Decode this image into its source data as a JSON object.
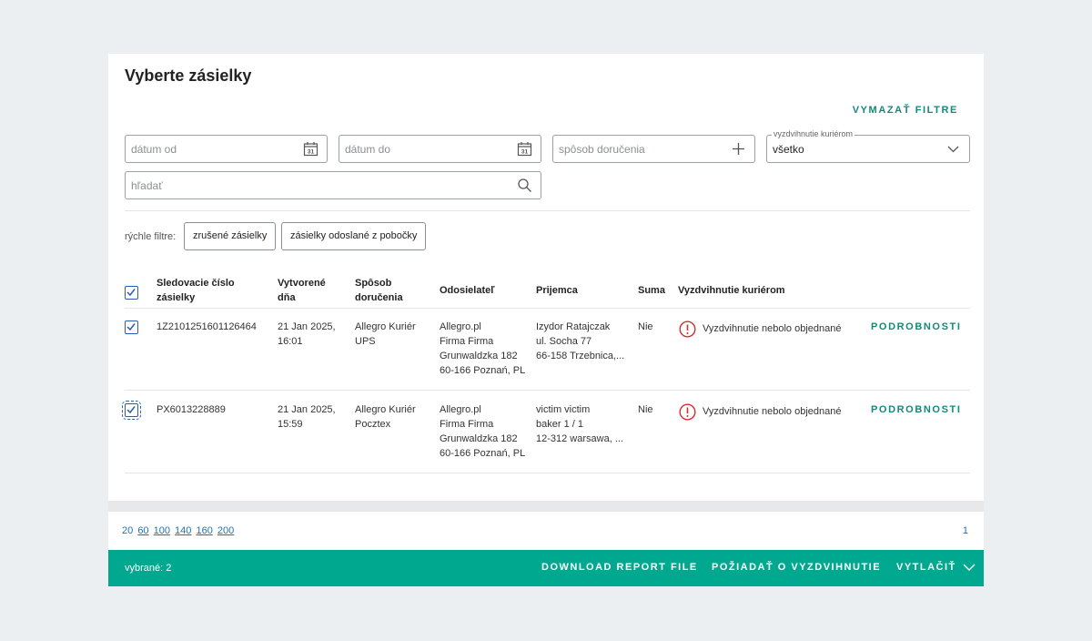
{
  "page_title": "Vyberte zásielky",
  "clear_filters": "VYMAZAŤ FILTRE",
  "filters": {
    "date_from_placeholder": "dátum od",
    "date_to_placeholder": "dátum do",
    "delivery_placeholder": "spôsob doručenia",
    "pickup_legend": "vyzdvihnutie kuriérom",
    "pickup_value": "všetko",
    "search_placeholder": "hľadať"
  },
  "quick_filters": {
    "label": "rýchle filtre:",
    "chips": [
      "zrušené zásielky",
      "zásielky odoslané z pobočky"
    ]
  },
  "table": {
    "headers": {
      "tracking": [
        "Sledovacie číslo",
        "zásielky"
      ],
      "created": [
        "Vytvorené",
        "dňa"
      ],
      "delivery": [
        "Spôsob",
        "doručenia"
      ],
      "sender": "Odosielateľ",
      "recipient": "Prijemca",
      "amount": "Suma",
      "pickup": "Vyzdvihnutie kuriérom"
    },
    "rows": [
      {
        "tracking": "1Z2101251601126464",
        "created": [
          "21 Jan 2025,",
          "16:01"
        ],
        "delivery": [
          "Allegro Kuriér",
          "UPS"
        ],
        "sender": [
          "Allegro.pl",
          "Firma Firma",
          "Grunwaldzka 182",
          "60-166 Poznań, PL"
        ],
        "recipient": [
          "Izydor Ratajczak",
          "ul. Socha 77",
          "66-158 Trzebnica,..."
        ],
        "amount": "Nie",
        "pickup_status": "Vyzdvihnutie nebolo objednané",
        "details": "PODROBNOSTI"
      },
      {
        "tracking": "PX6013228889",
        "created": [
          "21 Jan 2025,",
          "15:59"
        ],
        "delivery": [
          "Allegro Kuriér",
          "Pocztex"
        ],
        "sender": [
          "Allegro.pl",
          "Firma Firma",
          "Grunwaldzka 182",
          "60-166 Poznań, PL"
        ],
        "recipient": [
          "victim victim",
          "baker 1 / 1",
          "12-312 warsawa, ..."
        ],
        "amount": "Nie",
        "pickup_status": "Vyzdvihnutie nebolo objednané",
        "details": "PODROBNOSTI"
      }
    ]
  },
  "pagination": {
    "page_sizes": [
      "20",
      "60",
      "100",
      "140",
      "160",
      "200"
    ],
    "current_page": "1"
  },
  "footer": {
    "selected": "vybrané: 2",
    "download": "DOWNLOAD REPORT FILE",
    "request_pickup": "POŽIADAŤ O VYZDVIHNUTIE",
    "print": "VYTLAČIŤ"
  },
  "colors": {
    "accent": "#00a88f",
    "link_teal": "#128a7c",
    "checkbox_blue": "#2a5db0",
    "warning_red": "#d32f2f"
  },
  "icons": [
    "calendar-icon",
    "plus-icon",
    "chevron-down-icon",
    "search-icon",
    "checkbox-checked-icon",
    "warning-icon"
  ]
}
